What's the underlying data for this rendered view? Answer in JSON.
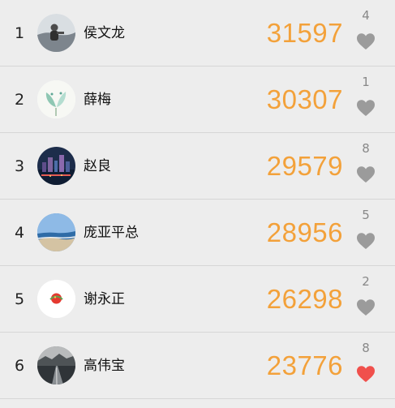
{
  "rows": [
    {
      "rank": "1",
      "name": "侯文龙",
      "score": "31597",
      "likes": "4",
      "liked": false
    },
    {
      "rank": "2",
      "name": "薛梅",
      "score": "30307",
      "likes": "1",
      "liked": false
    },
    {
      "rank": "3",
      "name": "赵良",
      "score": "29579",
      "likes": "8",
      "liked": false
    },
    {
      "rank": "4",
      "name": "庞亚平总",
      "score": "28956",
      "likes": "5",
      "liked": false
    },
    {
      "rank": "5",
      "name": "谢永正",
      "score": "26298",
      "likes": "2",
      "liked": false
    },
    {
      "rank": "6",
      "name": "高伟宝",
      "score": "23776",
      "likes": "8",
      "liked": true
    }
  ],
  "colors": {
    "score": "#f3a13a",
    "heart_inactive": "#9b9b9b",
    "heart_active": "#f0504c"
  }
}
